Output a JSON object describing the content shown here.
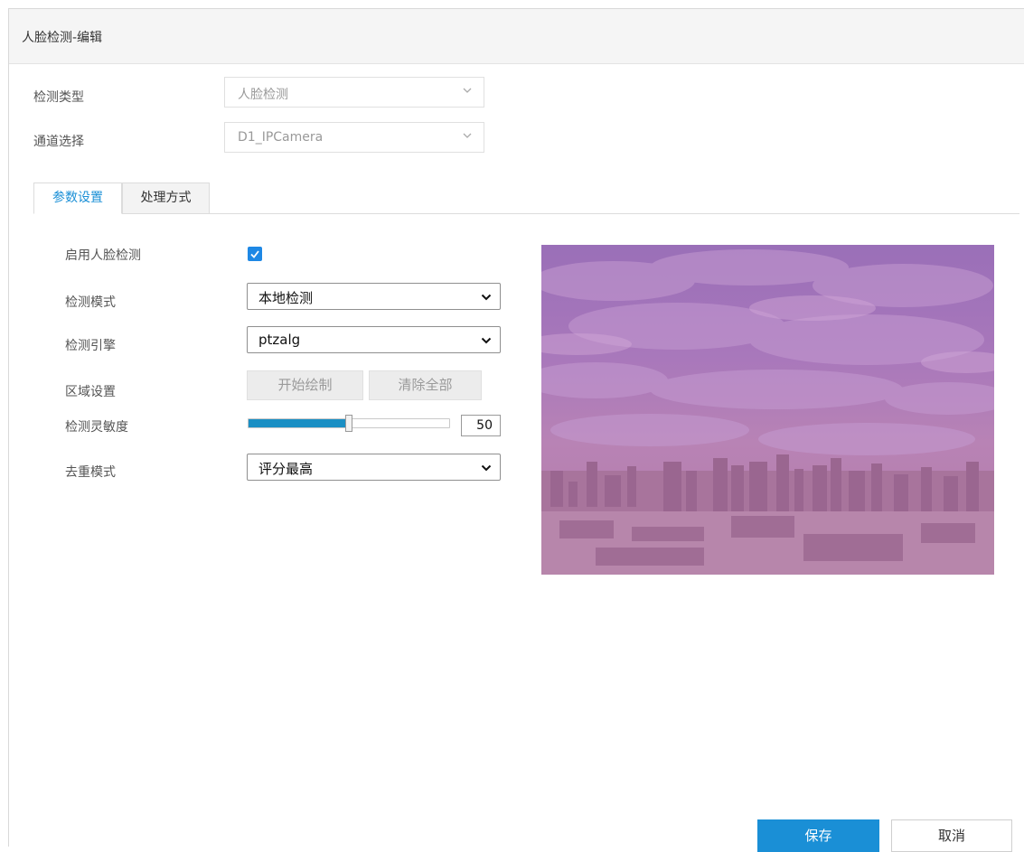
{
  "header": {
    "title": "人脸检测-编辑"
  },
  "detection_type": {
    "label": "检测类型",
    "value": "人脸检测"
  },
  "channel": {
    "label": "通道选择",
    "value": "D1_IPCamera"
  },
  "tabs": [
    {
      "label": "参数设置",
      "active": true
    },
    {
      "label": "处理方式",
      "active": false
    }
  ],
  "params": {
    "enable_label": "启用人脸检测",
    "enable_checked": true,
    "mode_label": "检测模式",
    "mode_value": "本地检测",
    "engine_label": "检测引擎",
    "engine_value": "ptzalg",
    "region_label": "区域设置",
    "start_draw_label": "开始绘制",
    "clear_all_label": "清除全部",
    "sensitivity_label": "检测灵敏度",
    "sensitivity_value": "50",
    "sensitivity_percent": 50,
    "dedup_label": "去重模式",
    "dedup_value": "评分最高"
  },
  "footer": {
    "save_label": "保存",
    "cancel_label": "取消"
  },
  "colors": {
    "accent": "#1a8fd6",
    "slider": "#1a8fc4",
    "checkbox": "#1e88e5"
  }
}
